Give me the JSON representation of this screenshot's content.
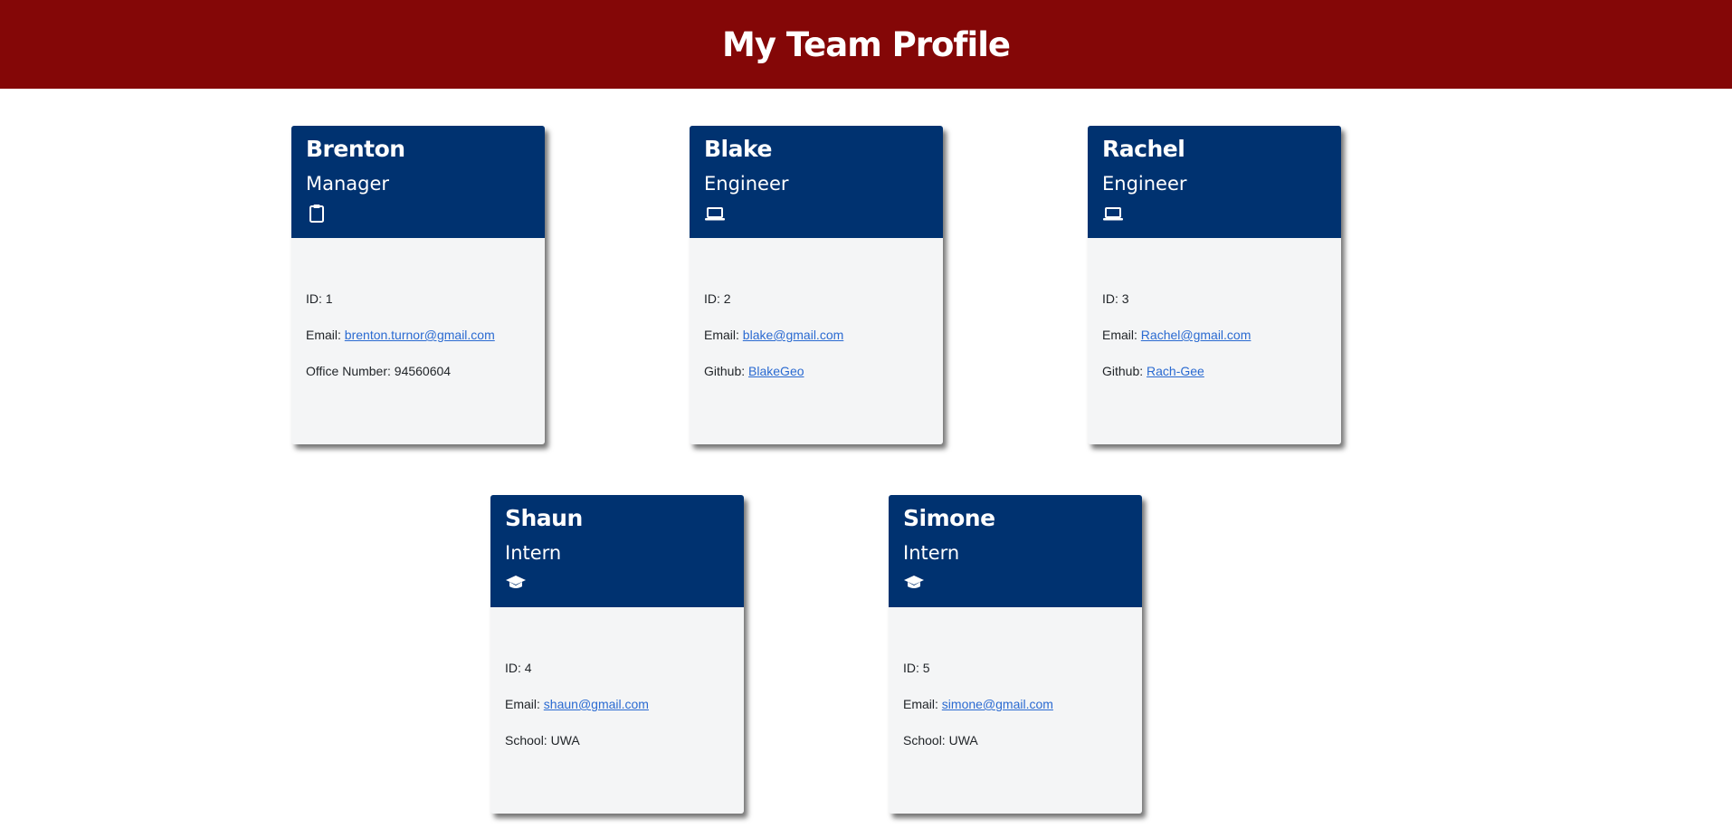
{
  "header": {
    "title": "My Team Profile"
  },
  "colors": {
    "banner": "#840707",
    "card_header": "#003270",
    "link": "#2a6ad1",
    "card_body": "#f4f5f6"
  },
  "labels": {
    "id": "ID: ",
    "email": "Email: ",
    "office": "Office Number: ",
    "github": "Github: ",
    "school": "School: "
  },
  "cards": [
    {
      "name": "Brenton",
      "role": "Manager",
      "icon": "clipboard-icon",
      "id": "1",
      "email": "brenton.turnor@gmail.com",
      "extra_label": "Office Number: ",
      "extra_value": "94560604"
    },
    {
      "name": "Blake",
      "role": "Engineer",
      "icon": "laptop-icon",
      "id": "2",
      "email": "blake@gmail.com",
      "extra_label": "Github: ",
      "extra_value": "BlakeGeo"
    },
    {
      "name": "Rachel",
      "role": "Engineer",
      "icon": "laptop-icon",
      "id": "3",
      "email": "Rachel@gmail.com",
      "extra_label": "Github: ",
      "extra_value": "Rach-Gee"
    },
    {
      "name": "Shaun",
      "role": "Intern",
      "icon": "graduation-cap-icon",
      "id": "4",
      "email": "shaun@gmail.com",
      "extra_label": "School: ",
      "extra_value": "UWA"
    },
    {
      "name": "Simone",
      "role": "Intern",
      "icon": "graduation-cap-icon",
      "id": "5",
      "email": "simone@gmail.com",
      "extra_label": "School: ",
      "extra_value": "UWA"
    }
  ]
}
